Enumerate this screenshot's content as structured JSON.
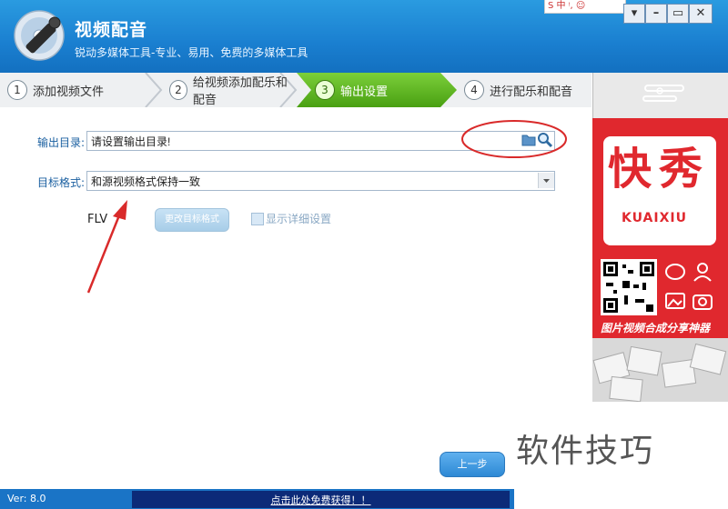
{
  "app": {
    "title": "视频配音",
    "subtitle": "锐动多媒体工具-专业、易用、免费的多媒体工具"
  },
  "window_controls": {
    "menu": "▾",
    "minimize": "–",
    "restore": "▭",
    "close": "✕"
  },
  "ime_bar": "S 中 ᵎ, ☺",
  "steps": [
    {
      "num": "1",
      "label": "添加视频文件",
      "active": false
    },
    {
      "num": "2",
      "label": "给视频添加配乐和配音",
      "active": false
    },
    {
      "num": "3",
      "label": "输出设置",
      "active": true
    },
    {
      "num": "4",
      "label": "进行配乐和配音",
      "active": false
    }
  ],
  "form": {
    "output_dir_label": "输出目录:",
    "output_dir_value": "请设置输出目录!",
    "target_format_label": "目标格式:",
    "target_format_value": "和源视频格式保持一致",
    "format_name": "FLV",
    "change_format_button": "更改目标格式",
    "show_details_label": "显示详细设置"
  },
  "ad": {
    "brand_cn_1": "快",
    "brand_cn_2": "秀",
    "brand_en": "KUAIXIU",
    "tagline": "图片视频合成分享神器"
  },
  "nav": {
    "prev_button": "上一步"
  },
  "watermark": "软件技巧",
  "footer": {
    "version": "Ver: 8.0",
    "link": "点击此处免费获得！！"
  },
  "colors": {
    "header_blue": "#1a7fd0",
    "active_step_green": "#5bb51f",
    "ad_red": "#e0282e",
    "annotation_red": "#d92a2a"
  }
}
